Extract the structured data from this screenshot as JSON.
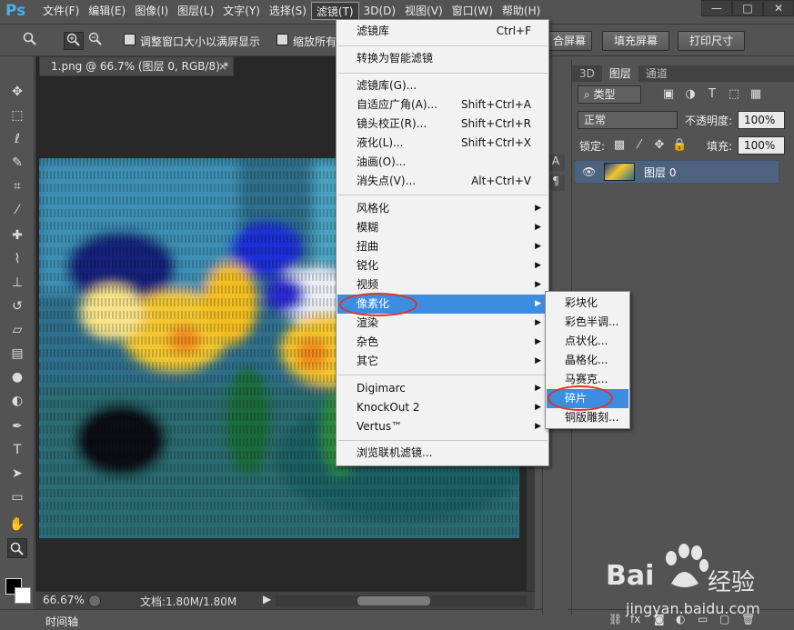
{
  "app": {
    "logo": "Ps"
  },
  "menubar": {
    "items": [
      "文件(F)",
      "编辑(E)",
      "图像(I)",
      "图层(L)",
      "文字(Y)",
      "选择(S)",
      "滤镜(T)",
      "3D(D)",
      "视图(V)",
      "窗口(W)",
      "帮助(H)"
    ],
    "active_index": 6,
    "window_controls": [
      "—",
      "□",
      "✕"
    ]
  },
  "options_bar": {
    "resize_window_label": "调整窗口大小以满屏显示",
    "zoom_all_label": "缩放所有",
    "fit_screen_label": "合屏幕",
    "fill_screen_label": "填充屏幕",
    "print_size_label": "打印尺寸"
  },
  "document": {
    "tab_title": "1.png @ 66.7% (图层 0, RGB/8) *",
    "tab_close": "×"
  },
  "statusbar": {
    "zoom": "66.67%",
    "doc_info": "文档:1.80M/1.80M"
  },
  "timeline": {
    "label": "时间轴"
  },
  "layers_panel": {
    "tabs": [
      "3D",
      "图层",
      "通道"
    ],
    "active_tab": 1,
    "kind_filter": "类型",
    "blend_mode": "正常",
    "opacity_label": "不透明度:",
    "opacity_value": "100%",
    "lock_label": "锁定:",
    "fill_label": "填充:",
    "fill_value": "100%",
    "layer_name": "图层 0"
  },
  "filter_menu": {
    "items": [
      {
        "label": "滤镜库",
        "shortcut": "Ctrl+F"
      },
      {
        "label": "转换为智能滤镜"
      },
      {
        "label": "滤镜库(G)..."
      },
      {
        "label": "自适应广角(A)...",
        "shortcut": "Shift+Ctrl+A"
      },
      {
        "label": "镜头校正(R)...",
        "shortcut": "Shift+Ctrl+R"
      },
      {
        "label": "液化(L)...",
        "shortcut": "Shift+Ctrl+X"
      },
      {
        "label": "油画(O)..."
      },
      {
        "label": "消失点(V)...",
        "shortcut": "Alt+Ctrl+V"
      },
      {
        "label": "风格化",
        "submenu": true
      },
      {
        "label": "模糊",
        "submenu": true
      },
      {
        "label": "扭曲",
        "submenu": true
      },
      {
        "label": "锐化",
        "submenu": true
      },
      {
        "label": "视频",
        "submenu": true
      },
      {
        "label": "像素化",
        "submenu": true,
        "highlighted": true
      },
      {
        "label": "渲染",
        "submenu": true
      },
      {
        "label": "杂色",
        "submenu": true
      },
      {
        "label": "其它",
        "submenu": true
      },
      {
        "label": "Digimarc",
        "submenu": true
      },
      {
        "label": "KnockOut 2",
        "submenu": true
      },
      {
        "label": "Vertus™",
        "submenu": true
      },
      {
        "label": "浏览联机滤镜..."
      }
    ]
  },
  "pixelate_submenu": {
    "items": [
      "彩块化",
      "彩色半调...",
      "点状化...",
      "晶格化...",
      "马赛克...",
      "碎片",
      "铜版雕刻..."
    ],
    "highlighted_index": 5
  },
  "watermark": {
    "brand": "Bai",
    "brand_suffix": "经验",
    "url": "jingyan.baidu.com"
  },
  "colors": {
    "highlight": "#3c8de0",
    "annotation": "#e0322a",
    "ps_blue": "#4eaeea"
  }
}
